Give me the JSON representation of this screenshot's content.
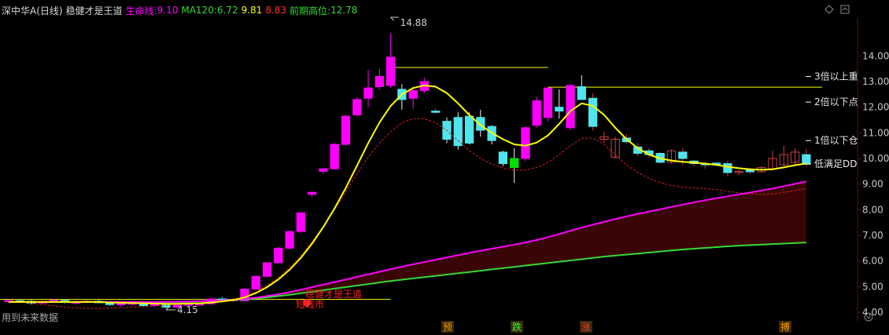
{
  "header": {
    "symbol": "深中华A(日线)",
    "indicator": "稳健才是王道",
    "life_line_label": "生命线:",
    "life_line_value": "9.10",
    "ma120_label": "MA120:",
    "ma120_value": "6.72",
    "v1": "9.81",
    "v2": "8.83",
    "prev_high_label": "前期高位:",
    "prev_high_value": "12.78"
  },
  "colors": {
    "up": "#ff00ff",
    "down": "#4ee5ee",
    "life_line": "#ff00ff",
    "ma120": "#34d934",
    "ma_fast": "#ffff00",
    "ma_dash": "#d22020",
    "fill": "#3a0505",
    "axis_text": "#c8c8c8",
    "grid": "#5a1010"
  },
  "chart_data": {
    "type": "candlestick",
    "ylim": [
      3.7,
      15.0
    ],
    "yticks": [
      "14.00",
      "13.00",
      "12.00",
      "11.00",
      "10.00",
      "9.00",
      "8.00",
      "7.00",
      "6.00",
      "5.00",
      "4.00"
    ],
    "annotations": {
      "high": "14.88",
      "low": "4.15",
      "multiple_labels": [
        "3倍以上重",
        "2倍以下点",
        "1倍以下仓",
        "低满足DD"
      ],
      "bottom_text": "用到未来数据",
      "red_text_1": "稳健才是王道",
      "red_text_2": "短线市",
      "markers": [
        "预",
        "跌",
        "涨",
        "搏"
      ]
    },
    "candles": [
      [
        4.42,
        4.5,
        4.38,
        4.46
      ],
      [
        4.45,
        4.52,
        4.4,
        4.43
      ],
      [
        4.43,
        4.48,
        4.3,
        4.35
      ],
      [
        4.36,
        4.45,
        4.32,
        4.42
      ],
      [
        4.42,
        4.5,
        4.4,
        4.47
      ],
      [
        4.46,
        4.5,
        4.35,
        4.38
      ],
      [
        4.38,
        4.44,
        4.3,
        4.4
      ],
      [
        4.4,
        4.46,
        4.36,
        4.43
      ],
      [
        4.43,
        4.48,
        4.35,
        4.37
      ],
      [
        4.37,
        4.42,
        4.25,
        4.3
      ],
      [
        4.3,
        4.38,
        4.2,
        4.34
      ],
      [
        4.34,
        4.4,
        4.28,
        4.36
      ],
      [
        4.36,
        4.4,
        4.22,
        4.26
      ],
      [
        4.26,
        4.34,
        4.2,
        4.31
      ],
      [
        4.31,
        4.36,
        4.15,
        4.2
      ],
      [
        4.2,
        4.3,
        4.15,
        4.28
      ],
      [
        4.28,
        4.35,
        4.24,
        4.32
      ],
      [
        4.32,
        4.38,
        4.28,
        4.33
      ],
      [
        4.33,
        4.55,
        4.3,
        4.52
      ],
      [
        4.52,
        4.6,
        4.4,
        4.45
      ],
      [
        4.45,
        4.55,
        4.4,
        4.5
      ],
      [
        4.45,
        4.95,
        4.42,
        4.9
      ],
      [
        4.9,
        5.45,
        4.88,
        5.4
      ],
      [
        5.4,
        5.95,
        5.38,
        5.93
      ],
      [
        5.93,
        6.55,
        5.9,
        6.5
      ],
      [
        6.5,
        7.2,
        6.45,
        7.15
      ],
      [
        7.15,
        7.9,
        7.1,
        7.88
      ],
      [
        8.6,
        8.7,
        8.5,
        8.68
      ],
      [
        9.5,
        9.62,
        9.4,
        9.6
      ],
      [
        9.6,
        10.6,
        9.55,
        10.55
      ],
      [
        10.55,
        11.7,
        10.5,
        11.65
      ],
      [
        11.7,
        12.4,
        11.65,
        12.3
      ],
      [
        12.35,
        13.45,
        12.0,
        12.75
      ],
      [
        12.8,
        13.5,
        12.7,
        13.2
      ],
      [
        12.85,
        14.88,
        12.75,
        13.95
      ],
      [
        12.7,
        12.9,
        11.9,
        12.3
      ],
      [
        12.35,
        12.8,
        11.95,
        12.65
      ],
      [
        12.65,
        13.15,
        12.55,
        13.0
      ],
      [
        11.85,
        11.95,
        11.75,
        11.8
      ],
      [
        11.45,
        11.6,
        10.6,
        10.75
      ],
      [
        11.6,
        11.8,
        10.35,
        10.5
      ],
      [
        11.65,
        11.8,
        10.55,
        10.6
      ],
      [
        11.6,
        11.9,
        10.85,
        11.1
      ],
      [
        11.25,
        11.3,
        10.55,
        10.7
      ],
      [
        10.25,
        10.3,
        9.7,
        9.8
      ],
      [
        10.0,
        10.4,
        9.05,
        9.65
      ],
      [
        10.0,
        11.25,
        9.9,
        11.2
      ],
      [
        11.3,
        12.4,
        11.2,
        12.25
      ],
      [
        11.6,
        12.8,
        11.45,
        12.75
      ],
      [
        12.0,
        12.7,
        11.55,
        11.85
      ],
      [
        11.2,
        12.9,
        11.1,
        12.85
      ],
      [
        12.8,
        13.25,
        12.3,
        12.3
      ],
      [
        12.35,
        12.55,
        11.1,
        11.25
      ],
      [
        10.75,
        11.05,
        10.6,
        10.85
      ],
      [
        10.05,
        10.85,
        10.0,
        10.75
      ],
      [
        10.8,
        10.95,
        10.6,
        10.65
      ],
      [
        10.45,
        10.6,
        10.1,
        10.2
      ],
      [
        10.3,
        10.4,
        10.05,
        10.15
      ],
      [
        10.2,
        10.25,
        9.8,
        9.85
      ],
      [
        9.85,
        10.35,
        9.8,
        10.3
      ],
      [
        10.25,
        10.4,
        9.75,
        10.0
      ],
      [
        9.9,
        9.95,
        9.7,
        9.8
      ],
      [
        9.8,
        9.85,
        9.6,
        9.75
      ],
      [
        9.82,
        9.86,
        9.78,
        9.8
      ],
      [
        9.8,
        9.9,
        9.3,
        9.45
      ],
      [
        9.48,
        9.55,
        9.35,
        9.5
      ],
      [
        9.55,
        9.62,
        9.4,
        9.48
      ],
      [
        9.48,
        9.7,
        9.45,
        9.65
      ],
      [
        9.6,
        10.3,
        9.55,
        10.0
      ],
      [
        9.75,
        10.5,
        9.7,
        10.15
      ],
      [
        9.85,
        10.4,
        9.7,
        10.25
      ],
      [
        10.15,
        10.35,
        9.7,
        9.8
      ]
    ],
    "ma_fast_y": [
      4.4,
      4.4,
      4.4,
      4.4,
      4.4,
      4.4,
      4.4,
      4.4,
      4.4,
      4.38,
      4.37,
      4.36,
      4.35,
      4.34,
      4.33,
      4.33,
      4.34,
      4.35,
      4.38,
      4.42,
      4.48,
      4.58,
      4.75,
      4.98,
      5.28,
      5.66,
      6.12,
      6.68,
      7.32,
      8.05,
      8.85,
      9.72,
      10.6,
      11.4,
      12.05,
      12.5,
      12.75,
      12.85,
      12.8,
      12.55,
      12.15,
      11.7,
      11.3,
      11.0,
      10.75,
      10.55,
      10.5,
      10.62,
      10.9,
      11.35,
      11.85,
      12.15,
      12.05,
      11.7,
      11.2,
      10.75,
      10.4,
      10.15,
      10.0,
      9.92,
      9.87,
      9.84,
      9.8,
      9.75,
      9.68,
      9.62,
      9.58,
      9.56,
      9.58,
      9.65,
      9.74,
      9.8
    ],
    "ma_dash_y": [
      4.45,
      4.4,
      4.35,
      4.3,
      4.25,
      4.2,
      4.17,
      4.15,
      4.15,
      4.16,
      4.18,
      4.2,
      4.22,
      4.25,
      4.28,
      4.3,
      4.32,
      4.35,
      4.38,
      4.42,
      4.5,
      4.62,
      4.8,
      5.05,
      5.35,
      5.75,
      6.2,
      6.75,
      7.35,
      8.0,
      8.7,
      9.4,
      10.05,
      10.6,
      11.05,
      11.4,
      11.55,
      11.55,
      11.4,
      11.1,
      10.7,
      10.3,
      10.0,
      9.78,
      9.62,
      9.55,
      9.55,
      9.65,
      9.85,
      10.15,
      10.5,
      10.78,
      10.8,
      10.55,
      10.15,
      9.75,
      9.45,
      9.22,
      9.05,
      8.95,
      8.88,
      8.85,
      8.82,
      8.78,
      8.72,
      8.66,
      8.62,
      8.6,
      8.62,
      8.68,
      8.75,
      8.83
    ],
    "life_line_y": [
      4.4,
      4.4,
      4.4,
      4.4,
      4.4,
      4.4,
      4.4,
      4.4,
      4.4,
      4.4,
      4.4,
      4.4,
      4.4,
      4.4,
      4.41,
      4.41,
      4.42,
      4.43,
      4.44,
      4.46,
      4.48,
      4.52,
      4.57,
      4.63,
      4.7,
      4.78,
      4.88,
      4.98,
      5.08,
      5.18,
      5.28,
      5.38,
      5.48,
      5.58,
      5.68,
      5.78,
      5.87,
      5.96,
      6.05,
      6.14,
      6.23,
      6.32,
      6.4,
      6.48,
      6.56,
      6.64,
      6.72,
      6.82,
      6.93,
      7.05,
      7.18,
      7.3,
      7.42,
      7.53,
      7.64,
      7.74,
      7.84,
      7.93,
      8.02,
      8.11,
      8.2,
      8.29,
      8.37,
      8.45,
      8.52,
      8.6,
      8.67,
      8.75,
      8.83,
      8.92,
      9.01,
      9.1
    ],
    "ma120_y": [
      4.4,
      4.4,
      4.4,
      4.4,
      4.4,
      4.4,
      4.4,
      4.4,
      4.4,
      4.4,
      4.4,
      4.4,
      4.4,
      4.4,
      4.4,
      4.4,
      4.41,
      4.42,
      4.43,
      4.45,
      4.47,
      4.5,
      4.54,
      4.58,
      4.63,
      4.68,
      4.74,
      4.8,
      4.86,
      4.92,
      4.98,
      5.04,
      5.1,
      5.16,
      5.22,
      5.27,
      5.32,
      5.37,
      5.42,
      5.47,
      5.52,
      5.57,
      5.62,
      5.67,
      5.72,
      5.77,
      5.82,
      5.87,
      5.92,
      5.97,
      6.02,
      6.07,
      6.12,
      6.17,
      6.21,
      6.25,
      6.29,
      6.33,
      6.37,
      6.41,
      6.45,
      6.48,
      6.51,
      6.54,
      6.57,
      6.6,
      6.62,
      6.64,
      6.66,
      6.68,
      6.7,
      6.72
    ],
    "hlines": [
      {
        "y": 13.55,
        "from": 34,
        "to": 48
      },
      {
        "y": 12.78,
        "from": 48,
        "to": 72
      },
      {
        "y": 4.5,
        "from": 0,
        "to": 34
      }
    ]
  }
}
